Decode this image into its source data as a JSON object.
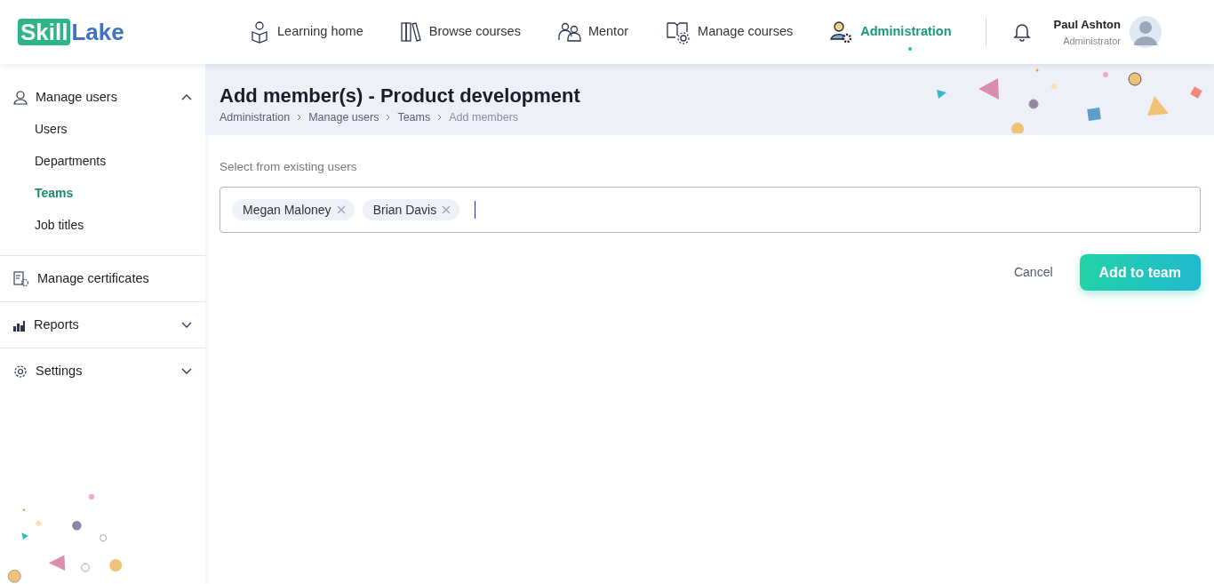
{
  "logo": {
    "part_1": "Skill",
    "part_2": "Lake"
  },
  "nav": [
    {
      "label": "Learning home",
      "selected": false
    },
    {
      "label": "Browse courses",
      "selected": false
    },
    {
      "label": "Mentor",
      "selected": false
    },
    {
      "label": "Manage courses",
      "selected": false
    },
    {
      "label": "Administration",
      "selected": true
    }
  ],
  "user": {
    "name": "Paul Ashton",
    "role": "Administrator"
  },
  "sidebar": [
    {
      "kind": "group",
      "label": "Manage users",
      "expanded": true,
      "children": [
        {
          "label": "Users",
          "selected": false
        },
        {
          "label": "Departments",
          "selected": false
        },
        {
          "label": "Teams",
          "selected": true
        },
        {
          "label": "Job titles",
          "selected": false
        }
      ]
    },
    {
      "kind": "link",
      "label": "Manage certificates"
    },
    {
      "kind": "group",
      "label": "Reports",
      "expanded": false
    },
    {
      "kind": "group",
      "label": "Settings",
      "expanded": false
    }
  ],
  "page": {
    "title": "Add member(s) - Product development",
    "breadcrumbs": [
      "Administration",
      "Manage users",
      "Teams",
      "Add members"
    ]
  },
  "form": {
    "label": "Select from existing users",
    "chips": [
      "Megan Maloney",
      "Brian Davis"
    ],
    "cancel": "Cancel",
    "submit": "Add to team"
  }
}
